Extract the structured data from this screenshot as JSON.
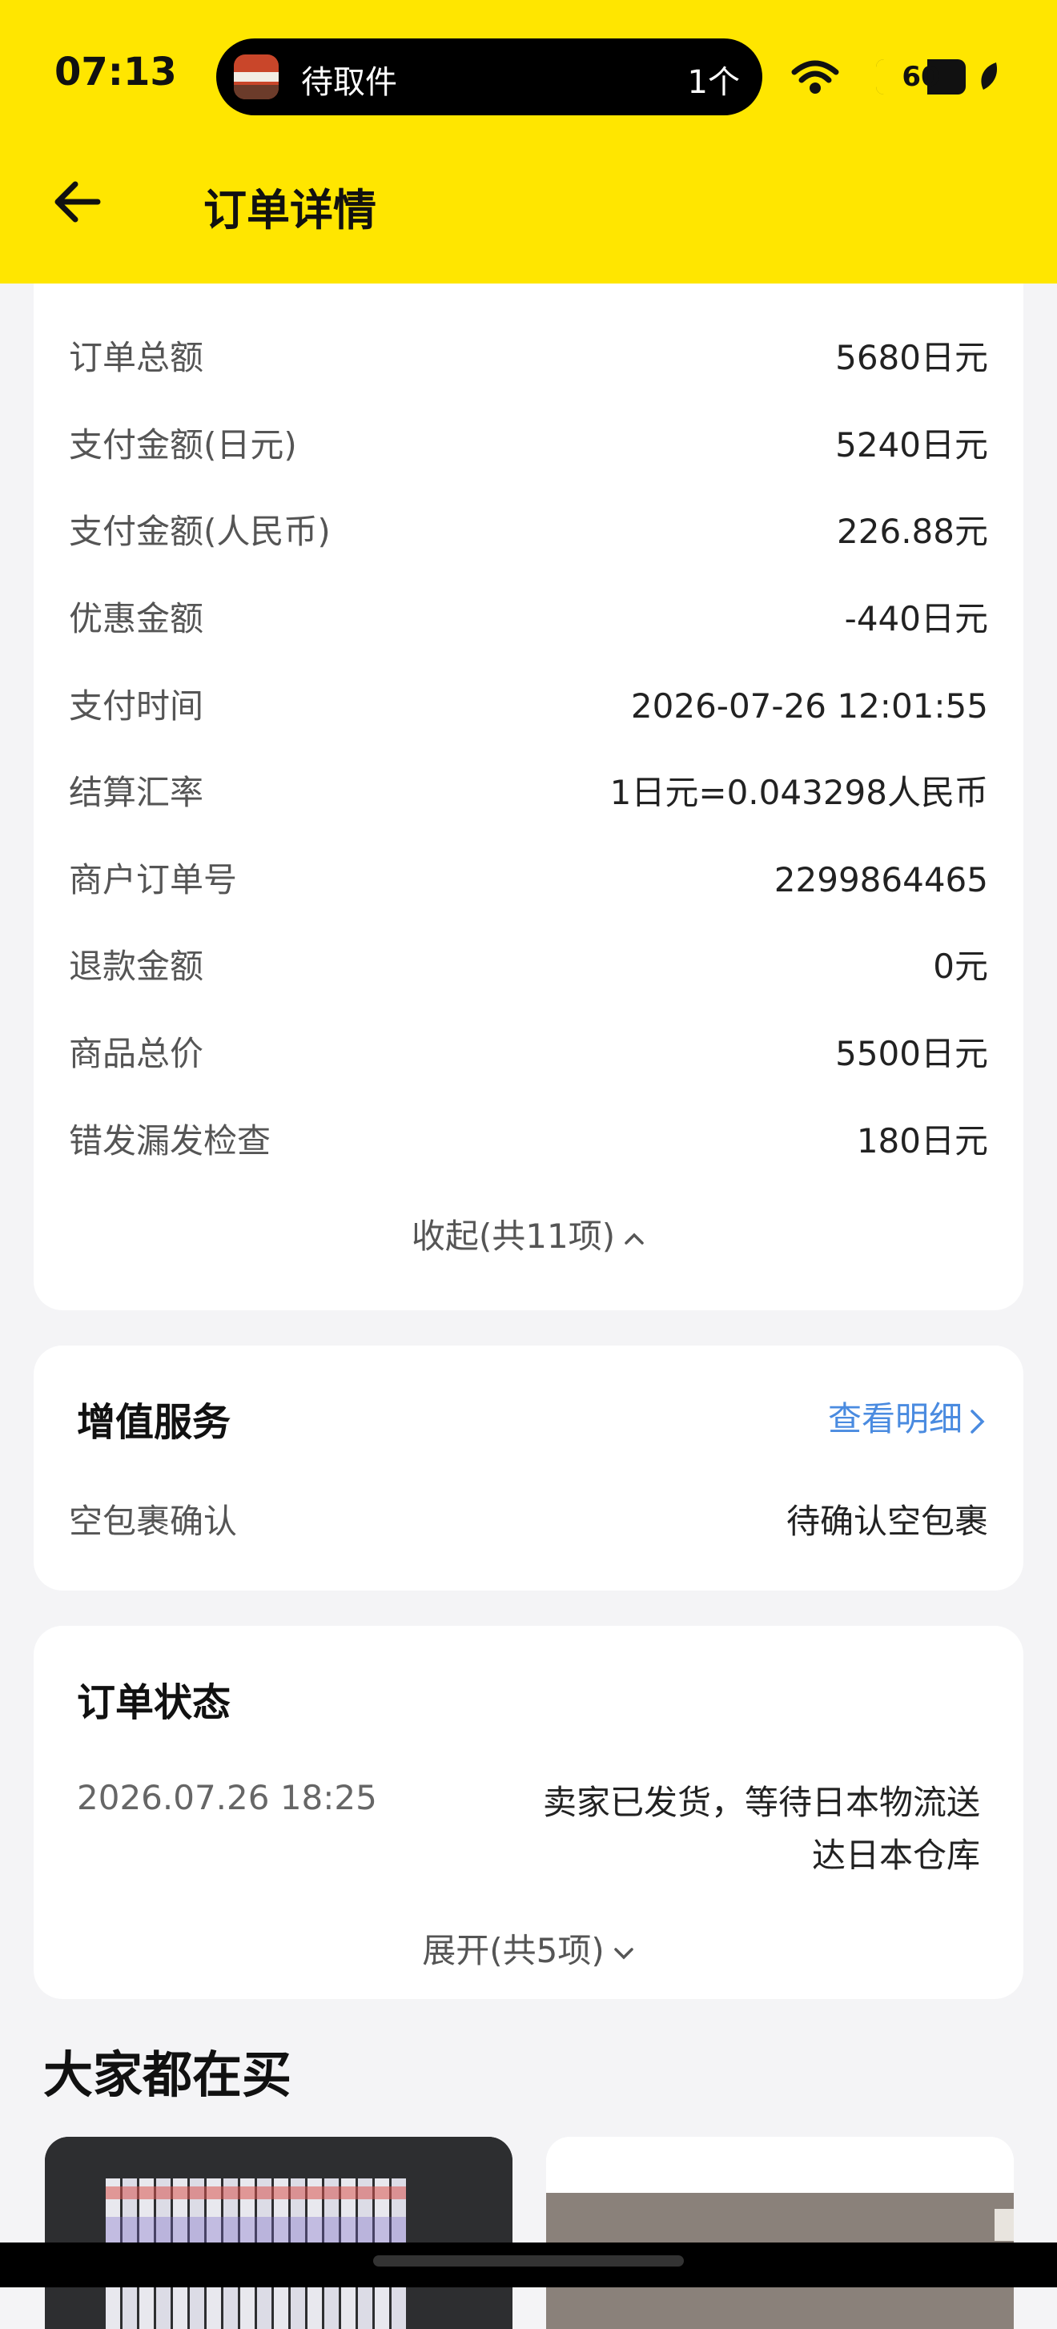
{
  "status_bar": {
    "time": "07:13",
    "island_label": "待取件",
    "island_count": "1个",
    "battery": "60"
  },
  "header": {
    "title": "订单详情"
  },
  "order_info": {
    "rows": [
      {
        "label": "订单总额",
        "value": "5680日元"
      },
      {
        "label": "支付金额(日元)",
        "value": "5240日元"
      },
      {
        "label": "支付金额(人民币)",
        "value": "226.88元"
      },
      {
        "label": "优惠金额",
        "value": "-440日元"
      },
      {
        "label": "支付时间",
        "value": "2026-07-26 12:01:55"
      },
      {
        "label": "结算汇率",
        "value": "1日元=0.043298人民币"
      },
      {
        "label": "商户订单号",
        "value": "2299864465"
      },
      {
        "label": "退款金额",
        "value": "0元"
      },
      {
        "label": "商品总价",
        "value": "5500日元"
      },
      {
        "label": "错发漏发检查",
        "value": "180日元"
      }
    ],
    "collapse_label": "收起(共11项)"
  },
  "value_added": {
    "title": "增值服务",
    "detail_link": "查看明细",
    "row_label": "空包裹确认",
    "row_value": "待确认空包裹"
  },
  "order_status": {
    "title": "订单状态",
    "time": "2026.07.26 18:25",
    "message_line1": "卖家已发货，等待日本物流送",
    "message_line2": "达日本仓库",
    "expand_label": "展开(共5项)"
  },
  "recommend": {
    "title": "大家都在买"
  },
  "colors": {
    "header_bg": "#ffe600",
    "link": "#4a8be0",
    "page_bg": "#f4f4f6"
  }
}
